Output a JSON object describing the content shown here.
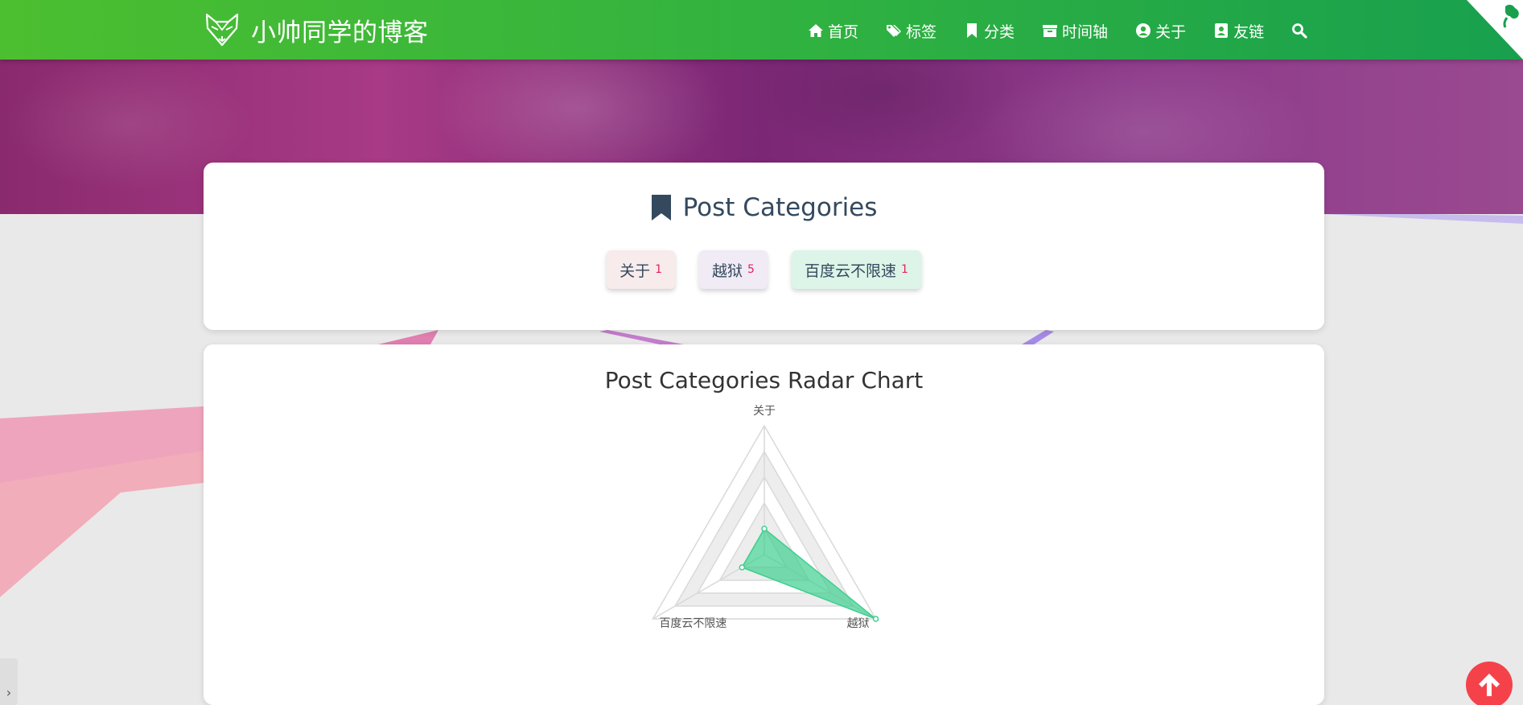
{
  "site": {
    "title": "小帅同学的博客",
    "brand_color": "#2fb141"
  },
  "nav": {
    "items": [
      {
        "label": "首页",
        "icon": "home-icon"
      },
      {
        "label": "标签",
        "icon": "tags-icon"
      },
      {
        "label": "分类",
        "icon": "bookmark-icon"
      },
      {
        "label": "时间轴",
        "icon": "archive-icon"
      },
      {
        "label": "关于",
        "icon": "user-circle-icon"
      },
      {
        "label": "友链",
        "icon": "address-book-icon"
      }
    ],
    "search_icon": "search-icon"
  },
  "categories_card": {
    "title": "Post Categories",
    "chips": [
      {
        "name": "关于",
        "count": "1",
        "color": "#f7ebeb"
      },
      {
        "name": "越狱",
        "count": "5",
        "color": "#f1ebf6"
      },
      {
        "name": "百度云不限速",
        "count": "1",
        "color": "#dcf5e8"
      }
    ]
  },
  "radar_card": {
    "title": "Post Categories Radar Chart"
  },
  "chart_data": {
    "type": "radar",
    "title": "Post Categories Radar Chart",
    "indicators": [
      "关于",
      "越狱",
      "百度云不限速"
    ],
    "series": [
      {
        "values": [
          1,
          5,
          1
        ]
      }
    ],
    "max": 5,
    "fill_color": "#3ecf8e",
    "legend": "none"
  }
}
